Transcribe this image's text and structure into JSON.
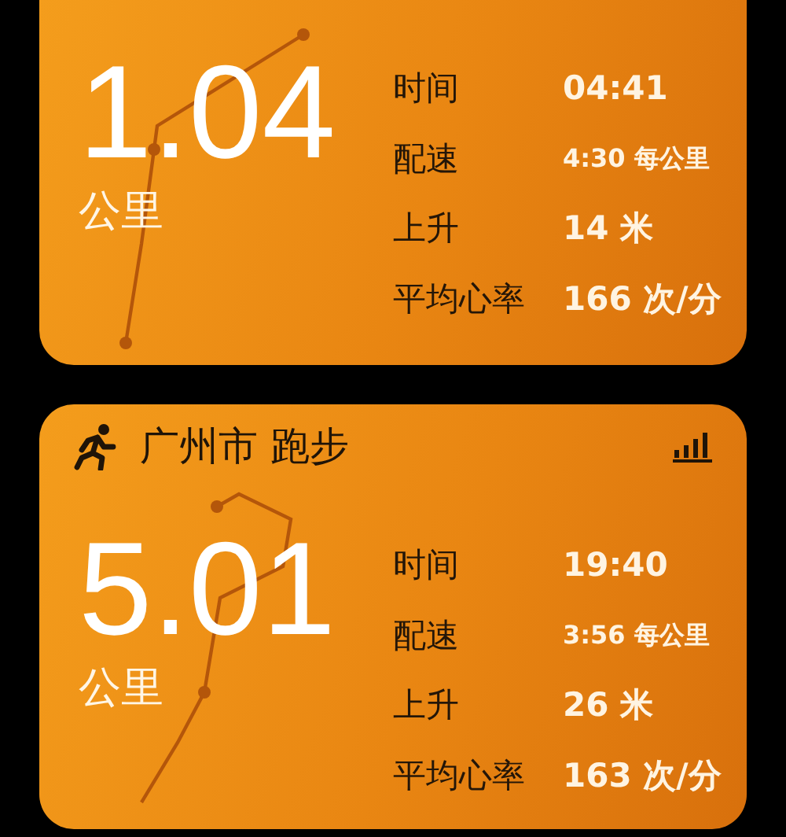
{
  "workouts": [
    {
      "distance": "1.04",
      "unit": "公里",
      "stats": [
        {
          "label": "时间",
          "value": "04:41",
          "kind": "standard"
        },
        {
          "label": "配速",
          "value": "4:30 每公里",
          "kind": "compact"
        },
        {
          "label": "上升",
          "value": "14 米",
          "kind": "standard"
        },
        {
          "label": "平均心率",
          "value": "166 次/分",
          "kind": "standard"
        }
      ]
    },
    {
      "title": "广州市 跑步",
      "distance": "5.01",
      "unit": "公里",
      "stats": [
        {
          "label": "时间",
          "value": "19:40",
          "kind": "standard"
        },
        {
          "label": "配速",
          "value": "3:56 每公里",
          "kind": "compact"
        },
        {
          "label": "上升",
          "value": "26 米",
          "kind": "standard"
        },
        {
          "label": "平均心率",
          "value": "163 次/分",
          "kind": "standard"
        }
      ]
    }
  ]
}
